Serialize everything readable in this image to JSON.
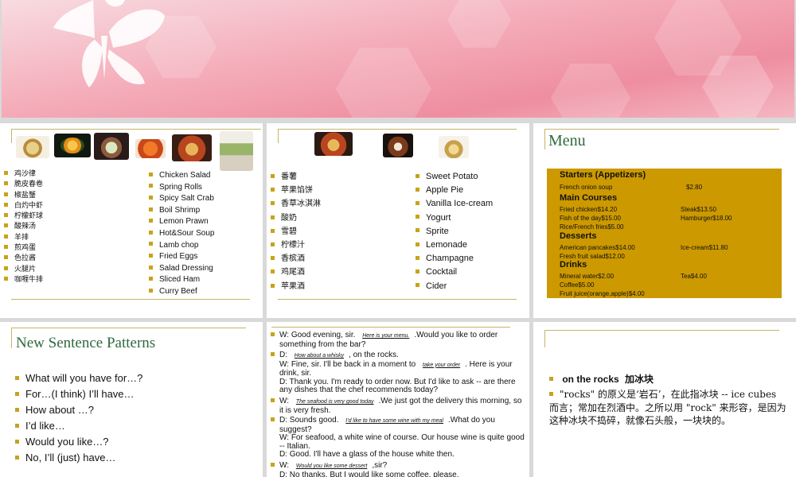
{
  "slide1": {},
  "slide2": {
    "chinese_items": [
      "鸡沙律",
      "脆皮春卷",
      "椒盐蟹",
      "白灼中虾",
      "柠檬虾球",
      "酸辣汤",
      "羊排",
      "煎鸡蛋",
      "色拉酱",
      "火腿片",
      "咖喱牛排"
    ],
    "english_items": [
      "Chicken Salad",
      "Spring Rolls",
      "Spicy Salt Crab",
      "Boil Shrimp",
      "Lemon Prawn",
      "Hot&Sour Soup",
      "Lamb chop",
      "Fried Eggs",
      "Salad Dressing",
      "Sliced Ham",
      "Curry Beef"
    ]
  },
  "slide3": {
    "chinese_items": [
      "番薯",
      "苹果馅饼",
      "香草冰淇淋",
      "酸奶",
      "雪碧",
      "柠檬汁",
      "香槟酒",
      "鸡尾酒",
      "苹果酒"
    ],
    "english_items": [
      "Sweet Potato",
      "Apple Pie",
      "Vanilla Ice-cream",
      "Yogurt",
      "Sprite",
      "Lemonade",
      "Champagne",
      "Cocktail",
      "Cider"
    ]
  },
  "slide4": {
    "title": "Menu",
    "starters_heading": "Starters (Appetizers)",
    "starters_item": "French onion soup",
    "starters_price": "$2.80",
    "main_heading": "Main Courses",
    "main_left": [
      "Fried chicken$14.20",
      "Fish of the day$15.00",
      "Rice/French fries$5.00"
    ],
    "main_right": [
      "Steak$13.50",
      "Hamburger$18.00"
    ],
    "desserts_heading": "Desserts",
    "desserts_left": [
      "American pancakes$14.00",
      "Fresh fruit salad$12.00"
    ],
    "desserts_right": [
      "Ice-cream$11.80"
    ],
    "drinks_heading": "Drinks",
    "drinks_left": [
      "Mineral water$2.00",
      "Coffee$5.00",
      "Fruit juice(orange,apple)$4.00"
    ],
    "drinks_right": [
      "Tea$4.00"
    ]
  },
  "slide5": {
    "title": "New Sentence Patterns",
    "items": [
      "What will you have for…?",
      "For…(I think) I’ll have…",
      "How about …?",
      "I’d like…",
      "Would you like…?",
      "No, I’ll (just) have…"
    ]
  },
  "slide6": {
    "l1a": "W: Good evening, sir.",
    "f1": "Here is your menu.",
    "l1b": ".Would you like to order something from the bar?",
    "l2a": "D:",
    "f2": "How about a whisky",
    "l2b": ", on the rocks.",
    "l2c": "W: Fine, sir. I'll be back in a moment to",
    "f3": "take your order",
    "l2d": ". Here is your drink, sir.",
    "l2e": "D: Thank you. I'm ready to order now. But I'd like to ask -- are there any dishes that the chef recommends today?",
    "l3a": "W:",
    "f4": "The seafood is very good today",
    "l3b": ".We just got the delivery this morning, so it is very fresh.",
    "l4a": "D: Sounds good.",
    "f5": "I'd like to have some wine with my meal",
    "l4b": ".What do you suggest?",
    "l4c": "W: For seafood, a white wine of course. Our house wine is quite good -- Italian.",
    "l4d": "D: Good. I'll have a glass of the house white then.",
    "l5a": "W:",
    "f6": "Would you like some dessert",
    "l5b": ",sir?",
    "l6": "D: No thanks. But I would like some coffee, please."
  },
  "slide7": {
    "term": "on the rocks",
    "term_zh": "加冰块",
    "explain": "\"rocks\" 的原义是‘岩石’，在此指冰块 -- ice cubes 而言；常加在烈酒中。之所以用 \"rock\" 来形容，是因为这种冰块不捣碎，就像石头般，一块块的。"
  }
}
